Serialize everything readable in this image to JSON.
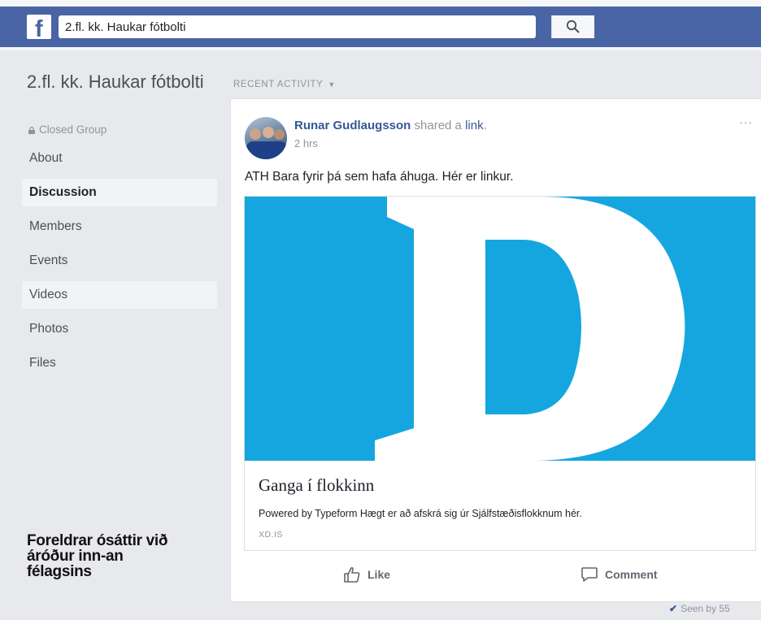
{
  "header": {
    "logo_letter": "f",
    "search_value": "2.fl. kk. Haukar fótbolti",
    "brand_color": "#4a65a6"
  },
  "sidebar": {
    "group_name": "2.fl. kk. Haukar fótbolti",
    "privacy": "Closed Group",
    "items": [
      {
        "label": "About"
      },
      {
        "label": "Discussion",
        "active": true
      },
      {
        "label": "Members"
      },
      {
        "label": "Events"
      },
      {
        "label": "Videos"
      },
      {
        "label": "Photos"
      },
      {
        "label": "Files"
      }
    ]
  },
  "caption": "Foreldrar ósáttir við áróður inn-an félagsins",
  "feed": {
    "section_label": "RECENT ACTIVITY",
    "post": {
      "author": "Runar Gudlaugsson",
      "verb": "shared a",
      "object": "link",
      "time": "2 hrs",
      "text": "ATH Bara fyrir þá sem hafa áhuga. Hér er linkur.",
      "link": {
        "image_letter": "D",
        "image_color": "#15a6e0",
        "title": "Ganga í flokkinn",
        "description": "Powered by Typeform Hægt er að afskrá sig úr Sjálfstæðisflokknum hér.",
        "domain": "XD.IS"
      },
      "actions": {
        "like": "Like",
        "comment": "Comment"
      },
      "seen": "Seen by 55"
    }
  }
}
